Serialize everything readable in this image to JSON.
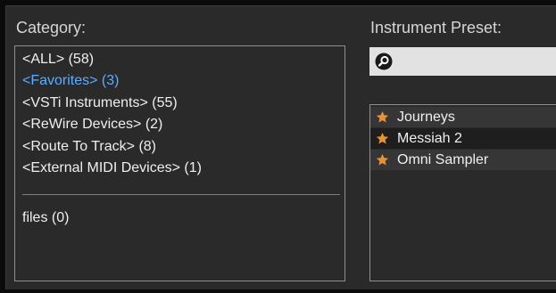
{
  "category": {
    "label": "Category:",
    "items": [
      {
        "label": "<ALL> (58)"
      },
      {
        "label": "<Favorites> (3)"
      },
      {
        "label": "<VSTi Instruments> (55)"
      },
      {
        "label": "<ReWire Devices> (2)"
      },
      {
        "label": "<Route To Track> (8)"
      },
      {
        "label": "<External MIDI Devices> (1)"
      }
    ],
    "selected_index": 1,
    "extra_items": [
      {
        "label": "files (0)"
      }
    ]
  },
  "preset": {
    "label": "Instrument Preset:",
    "search": {
      "value": "",
      "icon": "search-icon"
    },
    "items": [
      {
        "label": "Journeys",
        "favorite": true,
        "icon": "star-icon"
      },
      {
        "label": "Messiah 2",
        "favorite": true,
        "icon": "star-icon"
      },
      {
        "label": "Omni Sampler",
        "favorite": true,
        "icon": "star-icon"
      }
    ]
  },
  "colors": {
    "selected_text": "#5aaeff",
    "star": "#f0902a",
    "text": "#efefef",
    "label": "#d6d6d6"
  }
}
